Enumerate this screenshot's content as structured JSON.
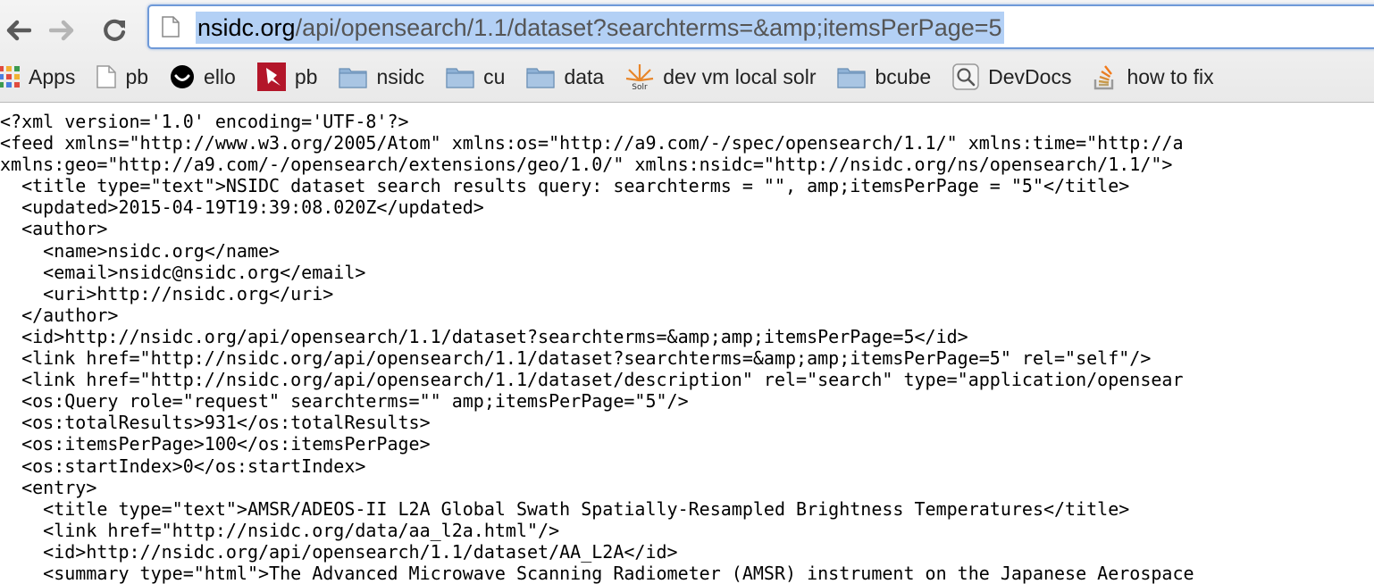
{
  "toolbar": {
    "url_host": "nsidc.org",
    "url_path": "/api/opensearch/1.1/dataset?searchterms=&amp;itemsPerPage=5"
  },
  "bookmarks": [
    {
      "label": "Apps",
      "icon": "apps-grid-icon"
    },
    {
      "label": "pb",
      "icon": "page-icon"
    },
    {
      "label": "ello",
      "icon": "ello-smile-icon"
    },
    {
      "label": "pb",
      "icon": "pushpin-icon"
    },
    {
      "label": "nsidc",
      "icon": "folder-icon"
    },
    {
      "label": "cu",
      "icon": "folder-icon"
    },
    {
      "label": "data",
      "icon": "folder-icon"
    },
    {
      "label": "dev vm local solr",
      "icon": "solr-icon"
    },
    {
      "label": "bcube",
      "icon": "folder-icon"
    },
    {
      "label": "DevDocs",
      "icon": "magnifier-icon"
    },
    {
      "label": "how to fix",
      "icon": "stackoverflow-icon"
    }
  ],
  "colors": {
    "selection": "#b3d0f5",
    "omnibox_border": "#6f9ad8",
    "folder_blue": "#7fa3c8"
  },
  "xml_lines": [
    "<?xml version='1.0' encoding='UTF-8'?>",
    "<feed xmlns=\"http://www.w3.org/2005/Atom\" xmlns:os=\"http://a9.com/-/spec/opensearch/1.1/\" xmlns:time=\"http://a",
    "xmlns:geo=\"http://a9.com/-/opensearch/extensions/geo/1.0/\" xmlns:nsidc=\"http://nsidc.org/ns/opensearch/1.1/\">",
    "  <title type=\"text\">NSIDC dataset search results query: searchterms = \"\", amp;itemsPerPage = \"5\"</title>",
    "  <updated>2015-04-19T19:39:08.020Z</updated>",
    "  <author>",
    "    <name>nsidc.org</name>",
    "    <email>nsidc@nsidc.org</email>",
    "    <uri>http://nsidc.org</uri>",
    "  </author>",
    "  <id>http://nsidc.org/api/opensearch/1.1/dataset?searchterms=&amp;amp;itemsPerPage=5</id>",
    "  <link href=\"http://nsidc.org/api/opensearch/1.1/dataset?searchterms=&amp;amp;itemsPerPage=5\" rel=\"self\"/>",
    "  <link href=\"http://nsidc.org/api/opensearch/1.1/dataset/description\" rel=\"search\" type=\"application/opensear",
    "  <os:Query role=\"request\" searchterms=\"\" amp;itemsPerPage=\"5\"/>",
    "  <os:totalResults>931</os:totalResults>",
    "  <os:itemsPerPage>100</os:itemsPerPage>",
    "  <os:startIndex>0</os:startIndex>",
    "  <entry>",
    "    <title type=\"text\">AMSR/ADEOS-II L2A Global Swath Spatially-Resampled Brightness Temperatures</title>",
    "    <link href=\"http://nsidc.org/data/aa_l2a.html\"/>",
    "    <id>http://nsidc.org/api/opensearch/1.1/dataset/AA_L2A</id>",
    "    <summary type=\"html\">The Advanced Microwave Scanning Radiometer (AMSR) instrument on the Japanese Aerospace"
  ]
}
